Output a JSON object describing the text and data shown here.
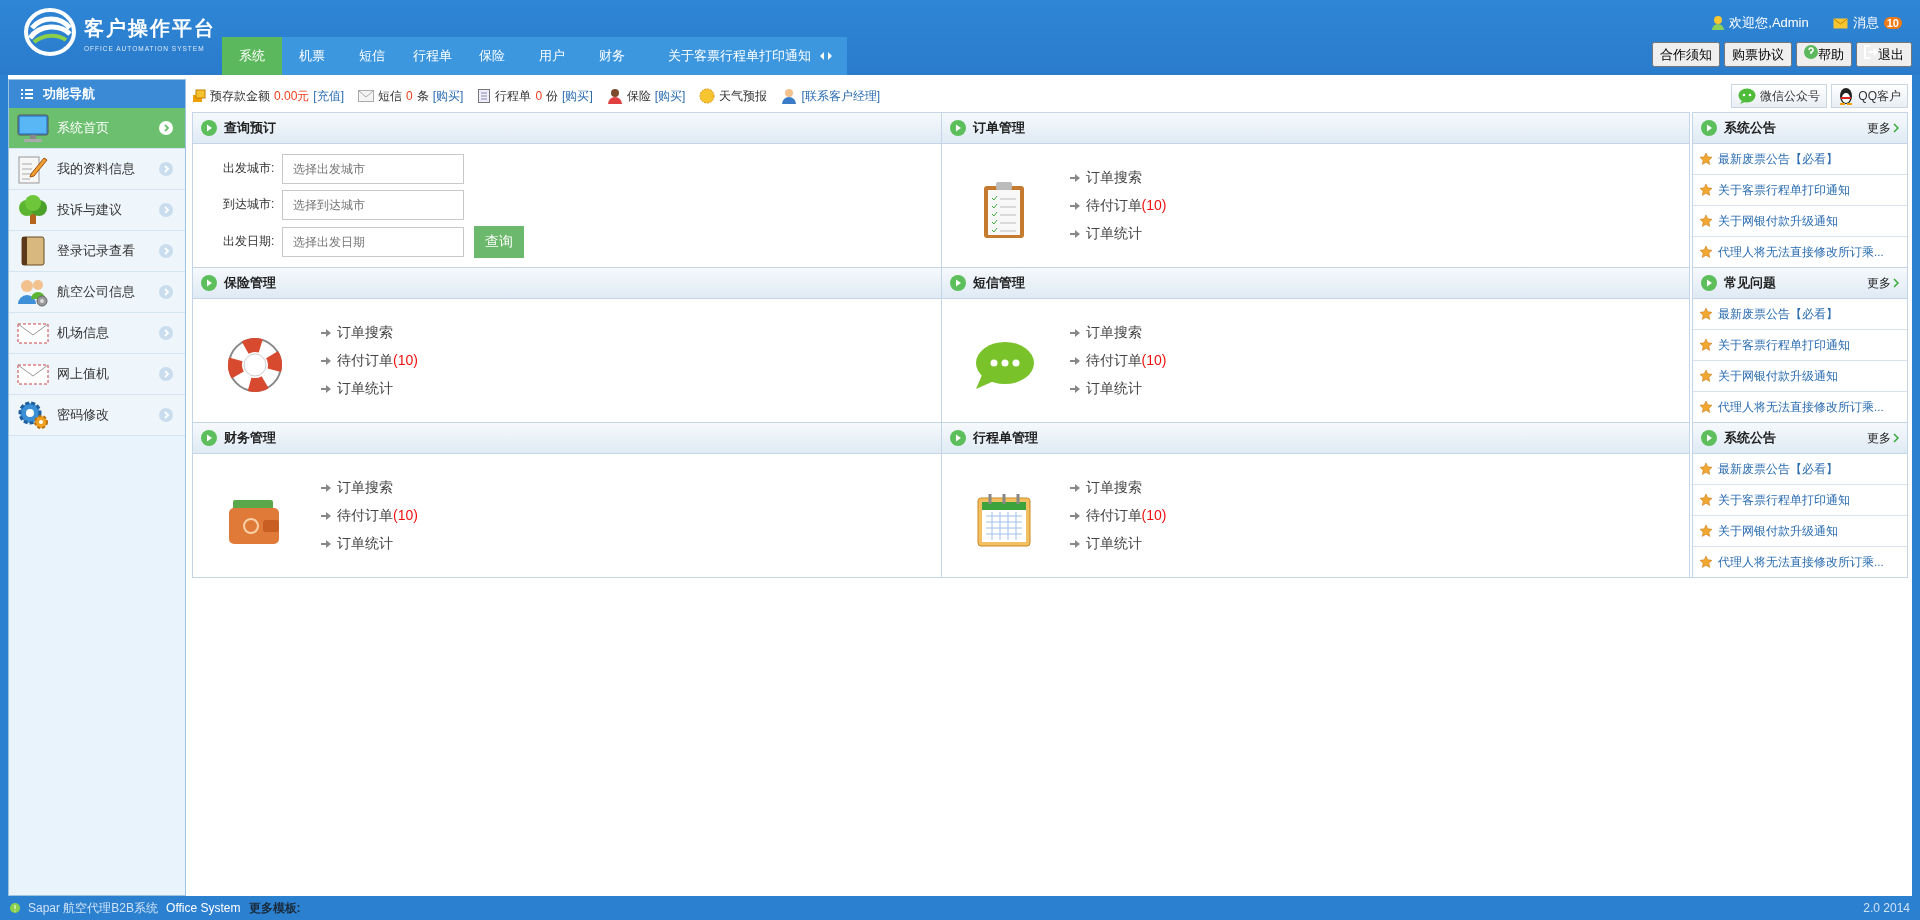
{
  "header": {
    "title": "客户操作平台",
    "subtitle": "OFFICE AUTOMATION SYSTEM",
    "nav": [
      {
        "label": "系统",
        "selected": true
      },
      {
        "label": "机票",
        "selected": false
      },
      {
        "label": "短信",
        "selected": false
      },
      {
        "label": "行程单",
        "selected": false
      },
      {
        "label": "保险",
        "selected": false
      },
      {
        "label": "用户",
        "selected": false
      },
      {
        "label": "财务",
        "selected": false
      }
    ],
    "notice": "关于客票行程单打印通知",
    "welcome": "欢迎您,Admin",
    "messages_label": "消息",
    "messages_count": "10",
    "buttons": [
      {
        "label": "合作须知",
        "kind": "plain"
      },
      {
        "label": "购票协议",
        "kind": "plain"
      },
      {
        "label": "帮助",
        "kind": "help"
      },
      {
        "label": "退出",
        "kind": "logout"
      }
    ]
  },
  "sidebar": {
    "title": "功能导航",
    "items": [
      {
        "label": "系统首页",
        "selected": true
      },
      {
        "label": "我的资料信息",
        "selected": false
      },
      {
        "label": "投诉与建议",
        "selected": false
      },
      {
        "label": "登录记录查看",
        "selected": false
      },
      {
        "label": "航空公司信息",
        "selected": false
      },
      {
        "label": "机场信息",
        "selected": false
      },
      {
        "label": "网上值机",
        "selected": false
      },
      {
        "label": "密码修改",
        "selected": false
      }
    ]
  },
  "info_bar": {
    "items": [
      {
        "label": "预存款金额",
        "count": "0.00元",
        "link": "[充值]"
      },
      {
        "label": "短信",
        "count": "0",
        "unit": "条",
        "link": "[购买]"
      },
      {
        "label": "行程单",
        "count": "0",
        "unit": "份",
        "link": "[购买]"
      },
      {
        "label": "保险",
        "link": "[购买]"
      },
      {
        "label": "天气预报"
      },
      {
        "link": "[联系客户经理]"
      }
    ],
    "buttons": [
      "微信公众号",
      "QQ客户"
    ]
  },
  "modules": [
    {
      "title": "查询预订",
      "kind": "form",
      "fields": [
        {
          "label": "出发城市:",
          "placeholder": "选择出发城市"
        },
        {
          "label": "到达城市:",
          "placeholder": "选择到达城市"
        },
        {
          "label": "出发日期:",
          "placeholder": "选择出发日期"
        }
      ],
      "button": "查询"
    },
    {
      "title": "订单管理",
      "kind": "links",
      "links": [
        {
          "text": "订单搜索"
        },
        {
          "text": "待付订单",
          "count": "(10)"
        },
        {
          "text": "订单统计"
        }
      ]
    },
    {
      "title": "保险管理",
      "kind": "links",
      "links": [
        {
          "text": "订单搜索"
        },
        {
          "text": "待付订单",
          "count": "(10)"
        },
        {
          "text": "订单统计"
        }
      ]
    },
    {
      "title": "短信管理",
      "kind": "links",
      "links": [
        {
          "text": "订单搜索"
        },
        {
          "text": "待付订单",
          "count": "(10)"
        },
        {
          "text": "订单统计"
        }
      ]
    },
    {
      "title": "财务管理",
      "kind": "links",
      "links": [
        {
          "text": "订单搜索"
        },
        {
          "text": "待付订单",
          "count": "(10)"
        },
        {
          "text": "订单统计"
        }
      ]
    },
    {
      "title": "行程单管理",
      "kind": "links",
      "links": [
        {
          "text": "订单搜索"
        },
        {
          "text": "待付订单",
          "count": "(10)"
        },
        {
          "text": "订单统计"
        }
      ]
    }
  ],
  "notices": [
    {
      "title": "系统公告",
      "more": "更多",
      "items": [
        "最新废票公告【必看】",
        "关于客票行程单打印通知",
        "关于网银付款升级通知",
        "代理人将无法直接修改所订乘..."
      ]
    },
    {
      "title": "常见问题",
      "more": "更多",
      "items": [
        "最新废票公告【必看】",
        "关于客票行程单打印通知",
        "关于网银付款升级通知",
        "代理人将无法直接修改所订乘..."
      ]
    },
    {
      "title": "系统公告",
      "more": "更多",
      "items": [
        "最新废票公告【必看】",
        "关于客票行程单打印通知",
        "关于网银付款升级通知",
        "代理人将无法直接修改所订乘..."
      ]
    }
  ],
  "footer": {
    "text": "Sapar 航空代理B2B系统",
    "brand": "Office System",
    "more": "更多模板:",
    "version": "2.0 2014"
  }
}
